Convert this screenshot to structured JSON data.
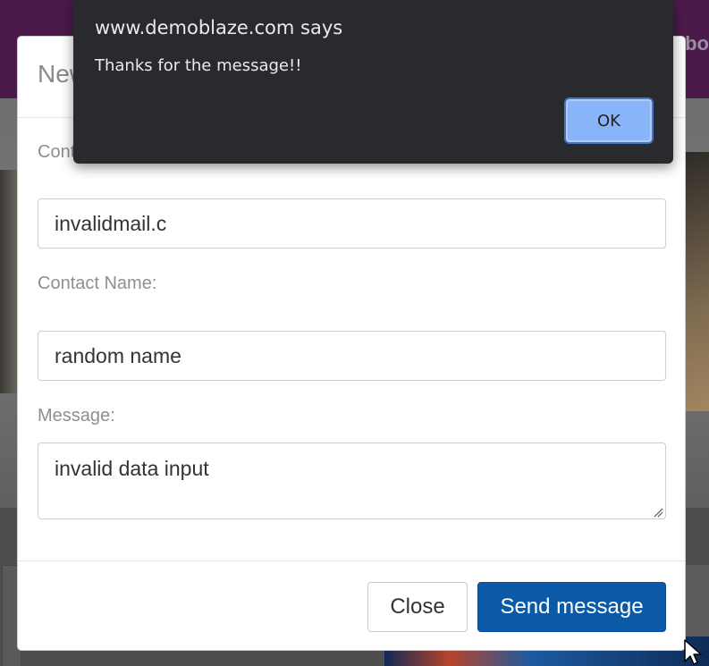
{
  "background": {
    "navbar_fragment": "bo"
  },
  "modal": {
    "title": "New message",
    "email_label": "Contact Email:",
    "email_value": "invalidmail.c",
    "name_label": "Contact Name:",
    "name_value": "random name",
    "message_label": "Message:",
    "message_value": "invalid data input",
    "close_label": "Close",
    "send_label": "Send message"
  },
  "alert": {
    "title": "www.demoblaze.com says",
    "message": "Thanks for the message!!",
    "ok_label": "OK"
  },
  "colors": {
    "send_button": "#0b5aa8",
    "alert_background": "#292a2d",
    "ok_button": "#8ab4f8"
  },
  "icons": {
    "cursor": "mouse-pointer-icon",
    "resize": "resize-grip-icon"
  }
}
